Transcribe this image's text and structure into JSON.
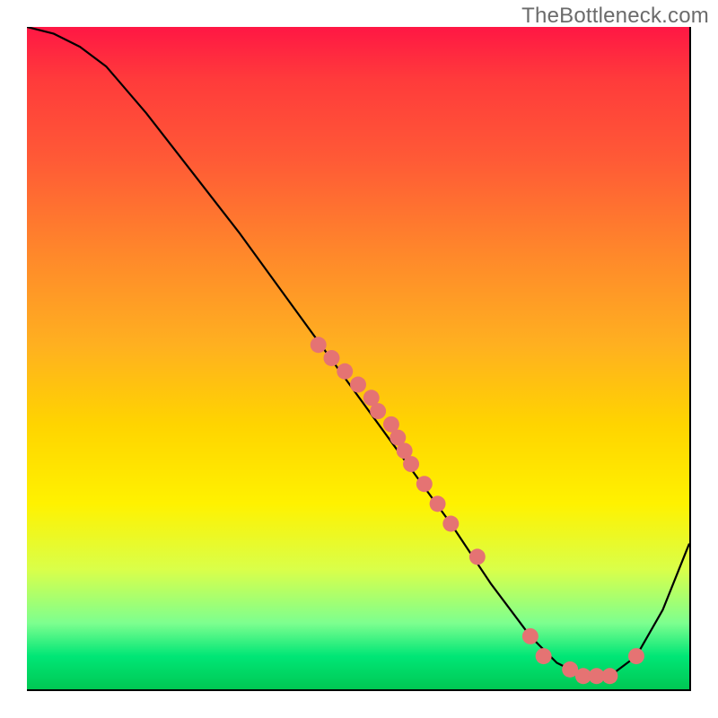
{
  "watermark": "TheBottleneck.com",
  "chart_data": {
    "type": "line",
    "title": "",
    "xlabel": "",
    "ylabel": "",
    "xlim": [
      0,
      100
    ],
    "ylim": [
      0,
      100
    ],
    "series": [
      {
        "name": "curve",
        "x": [
          0,
          4,
          8,
          12,
          18,
          25,
          32,
          40,
          48,
          56,
          64,
          70,
          76,
          80,
          84,
          88,
          92,
          96,
          100
        ],
        "y": [
          100,
          99,
          97,
          94,
          87,
          78,
          69,
          58,
          47,
          36,
          25,
          16,
          8,
          4,
          2,
          2,
          5,
          12,
          22
        ]
      }
    ],
    "points": [
      {
        "x": 44,
        "y": 52
      },
      {
        "x": 46,
        "y": 50
      },
      {
        "x": 48,
        "y": 48
      },
      {
        "x": 50,
        "y": 46
      },
      {
        "x": 52,
        "y": 44
      },
      {
        "x": 53,
        "y": 42
      },
      {
        "x": 55,
        "y": 40
      },
      {
        "x": 56,
        "y": 38
      },
      {
        "x": 57,
        "y": 36
      },
      {
        "x": 58,
        "y": 34
      },
      {
        "x": 60,
        "y": 31
      },
      {
        "x": 62,
        "y": 28
      },
      {
        "x": 64,
        "y": 25
      },
      {
        "x": 68,
        "y": 20
      },
      {
        "x": 76,
        "y": 8
      },
      {
        "x": 78,
        "y": 5
      },
      {
        "x": 82,
        "y": 3
      },
      {
        "x": 84,
        "y": 2
      },
      {
        "x": 86,
        "y": 2
      },
      {
        "x": 88,
        "y": 2
      },
      {
        "x": 92,
        "y": 5
      }
    ],
    "gradient_note": "background gradient red→orange→yellow→green top→bottom; green = low bottleneck at curve minimum"
  }
}
